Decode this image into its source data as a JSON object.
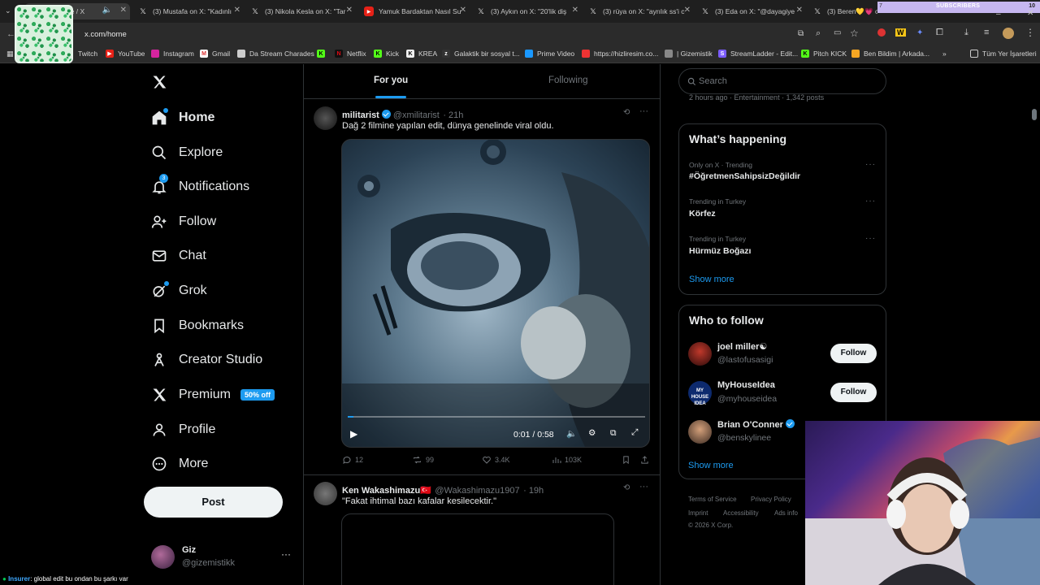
{
  "browser": {
    "tabs": [
      {
        "label": "(3) Home / X",
        "active": true
      },
      {
        "label": "(3) Mustafa on X: \"Kadınlı"
      },
      {
        "label": "(3) Nikola Kesla on X: \"Tar"
      },
      {
        "label": "Yamuk Bardaktan Nasıl Su"
      },
      {
        "label": "(3) Aykın on X: \"20'lik diş"
      },
      {
        "label": "(3) rüya on X: \"ayrılık ss'i c"
      },
      {
        "label": "(3) Eda on X: \"@dayagiye"
      },
      {
        "label": "(3) Beren💛💗 on X"
      }
    ],
    "url": "x.com/home",
    "bookmarks": [
      "Twitch",
      "YouTube",
      "Instagram",
      "Gmail",
      "Da Stream Charades",
      "",
      "Netflix",
      "Kick",
      "KREA",
      "Galaktik bir sosyal t...",
      "Prime Video",
      "https://hizliresim.co...",
      "| Gizemistik",
      "StreamLadder - Edit...",
      "Pitch KICK",
      "Ben Bildim | Arkada..."
    ],
    "bookmarks_folder": "Tüm Yer İşaretleri",
    "subscribers_label": "SUBSCRIBERS",
    "subscribers_start": "7",
    "subscribers_goal": "10"
  },
  "nav": {
    "items": [
      {
        "label": "Home",
        "icon": "home-icon"
      },
      {
        "label": "Explore",
        "icon": "search-icon"
      },
      {
        "label": "Notifications",
        "icon": "bell-icon",
        "badge": "3"
      },
      {
        "label": "Follow",
        "icon": "person-add-icon"
      },
      {
        "label": "Chat",
        "icon": "mail-icon"
      },
      {
        "label": "Grok",
        "icon": "grok-icon"
      },
      {
        "label": "Bookmarks",
        "icon": "bookmark-icon"
      },
      {
        "label": "Creator Studio",
        "icon": "creator-icon"
      },
      {
        "label": "Premium",
        "icon": "x-logo-icon",
        "promo": "50% off"
      },
      {
        "label": "Profile",
        "icon": "person-icon"
      },
      {
        "label": "More",
        "icon": "more-circle-icon"
      }
    ],
    "post_label": "Post",
    "account": {
      "name": "Giz",
      "handle": "@gizemistikk"
    }
  },
  "feed": {
    "tabs": [
      "For you",
      "Following"
    ],
    "tweets": [
      {
        "name": "militarist",
        "handle": "@xmilitarist",
        "time": "· 21h",
        "text": "Dağ 2 filmine yapılan edit, dünya genelinde viral oldu.",
        "video_time": "0:01 / 0:58",
        "video_progress": 0.02,
        "replies": "12",
        "reposts": "99",
        "likes": "3.4K",
        "views": "103K"
      },
      {
        "name": "Ken Wakashimazu🇹🇷",
        "handle": "@Wakashimazu1907",
        "time": "· 19h",
        "text": "\"Fakat ihtimal bazı kafalar kesilecektir.\""
      }
    ]
  },
  "right": {
    "search_placeholder": "Search",
    "top_meta": "2 hours ago · Entertainment · 1,342 posts",
    "happening_title": "What’s happening",
    "trends": [
      {
        "meta": "Only on X · Trending",
        "name": "#ÖğretmenSahipsizDeğildir"
      },
      {
        "meta": "Trending in Turkey",
        "name": "Körfez"
      },
      {
        "meta": "Trending in Turkey",
        "name": "Hürmüz Boğazı"
      }
    ],
    "show_more": "Show more",
    "who_title": "Who to follow",
    "who": [
      {
        "name": "joel miller☯",
        "handle": "@lastofusasigi",
        "button": "Follow"
      },
      {
        "name": "MyHouseIdea",
        "handle": "@myhouseidea",
        "button": "Follow"
      },
      {
        "name": "Brian O'Conner",
        "handle": "@benskylinee"
      }
    ],
    "footer": [
      "Terms of Service",
      "Privacy Policy",
      "Imprint",
      "Accessibility",
      "Ads info",
      "© 2026 X Corp."
    ]
  },
  "chat": {
    "user": "Insurer",
    "message": ": global edit bu ondan bu şarkı var"
  },
  "colors": {
    "accent": "#1d9bf0",
    "bg": "#000000",
    "border": "#2f3336",
    "muted": "#71767b"
  }
}
